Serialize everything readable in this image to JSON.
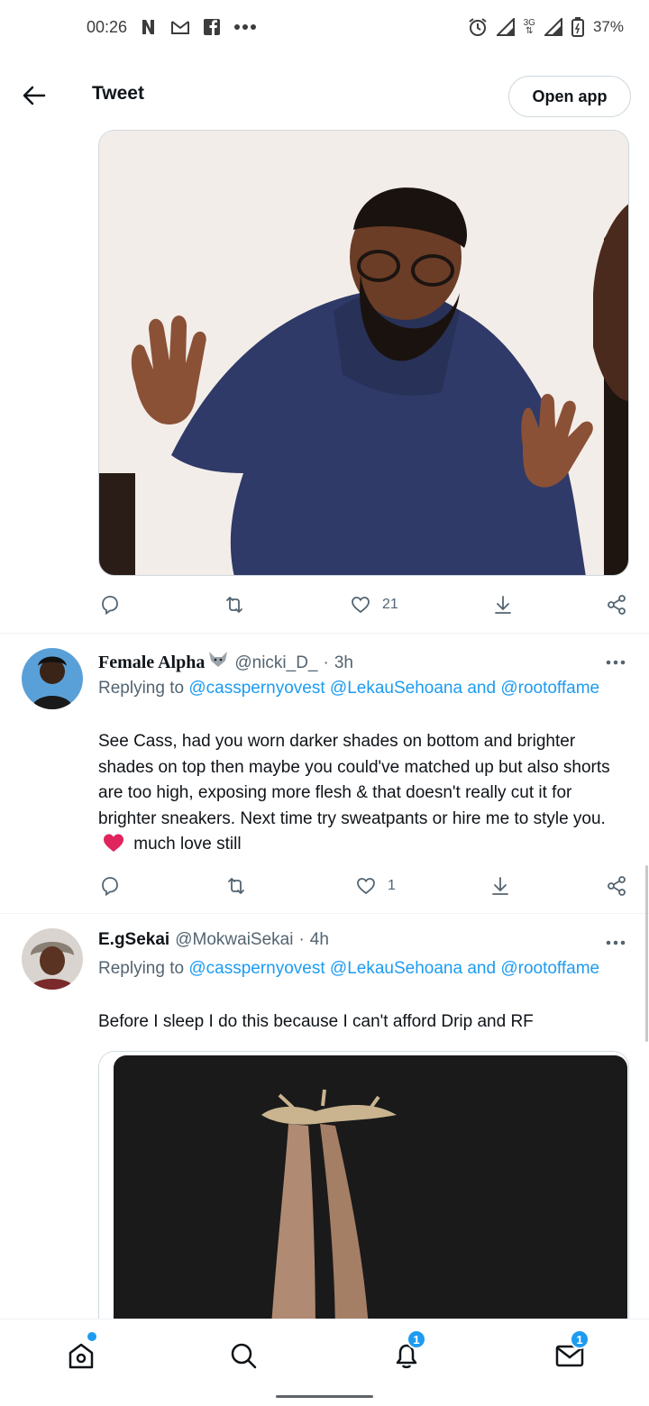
{
  "status_bar": {
    "time": "00:26",
    "network": "3G",
    "battery": "37%",
    "left_icons": [
      "netflix-n-icon",
      "gmail-icon",
      "facebook-icon",
      "more-dots-icon"
    ],
    "right_icons": [
      "alarm-icon",
      "signal-icon",
      "signal-icon",
      "battery-icon"
    ]
  },
  "header": {
    "title": "Tweet",
    "open_app_label": "Open app"
  },
  "main_tweet": {
    "media_icon": "photo-image",
    "actions": {
      "reply_count": "",
      "retweet_count": "",
      "like_count": "21"
    }
  },
  "replies": [
    {
      "name": "Female Alpha",
      "name_emoji": "wolf-emoji",
      "handle": "@nicki_D_",
      "time": "3h",
      "replying_label": "Replying to",
      "mentions": [
        "@casspernyovest",
        "@LekauSehoana"
      ],
      "and_label": "and",
      "mention_last": "@rootoffame",
      "text": "See Cass, had you worn darker shades on bottom and brighter shades on top then maybe you could've matched up but also shorts are too high, exposing more flesh & that doesn't really cut it for brighter sneakers. Next time try sweatpants or hire me to style you.",
      "text_tail": "much love still",
      "heart_emoji": "red-heart-emoji",
      "like_count": "1"
    },
    {
      "name": "E.gSekai",
      "handle": "@MokwaiSekai",
      "time": "4h",
      "replying_label": "Replying to",
      "mentions": [
        "@casspernyovest",
        "@LekauSehoana"
      ],
      "and_label": "and",
      "mention_last": "@rootoffame",
      "text": "Before I sleep I do this because I can't afford Drip and RF"
    }
  ],
  "bottom_nav": {
    "items": [
      {
        "name": "home",
        "icon": "home-icon",
        "dot": true
      },
      {
        "name": "search",
        "icon": "search-icon"
      },
      {
        "name": "notifications",
        "icon": "bell-icon",
        "badge": "1"
      },
      {
        "name": "messages",
        "icon": "envelope-icon",
        "badge": "1"
      }
    ]
  },
  "colors": {
    "accent": "#1d9bf0",
    "text": "#0f1419",
    "secondary": "#536471",
    "heart": "#e0245e"
  }
}
